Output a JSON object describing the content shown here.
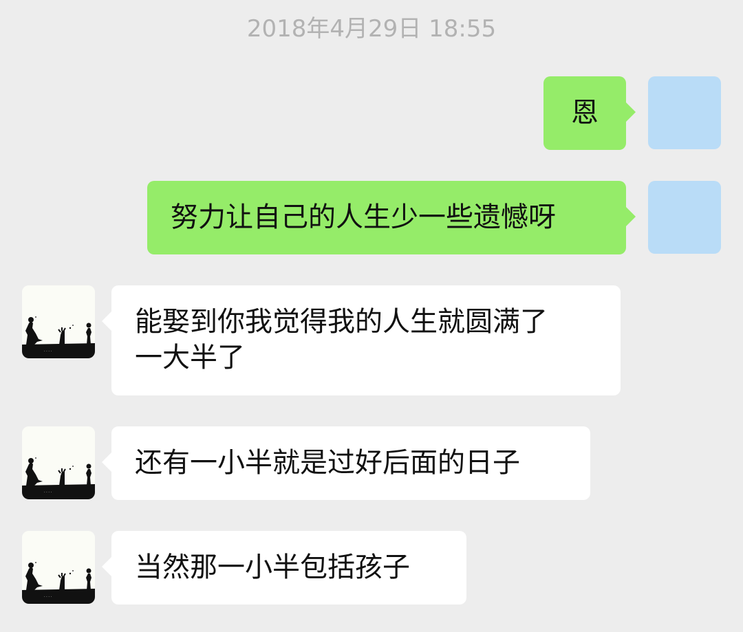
{
  "timestamp": "2018年4月29日 18:55",
  "messages": [
    {
      "from": "me",
      "lines": [
        "恩"
      ]
    },
    {
      "from": "me",
      "lines": [
        "努力让自己的人生少一些遗憾呀"
      ]
    },
    {
      "from": "friend",
      "lines": [
        "能娶到你我觉得我的人生就圆满了",
        "一大半了"
      ]
    },
    {
      "from": "friend",
      "lines": [
        "还有一小半就是过好后面的日子"
      ]
    },
    {
      "from": "friend",
      "lines": [
        "当然那一小半包括孩子"
      ]
    }
  ],
  "colors": {
    "background": "#ededed",
    "sent_bubble": "#95ec69",
    "received_bubble": "#ffffff",
    "timestamp_text": "#b2b2b2",
    "my_avatar": "#b9dcf7"
  }
}
